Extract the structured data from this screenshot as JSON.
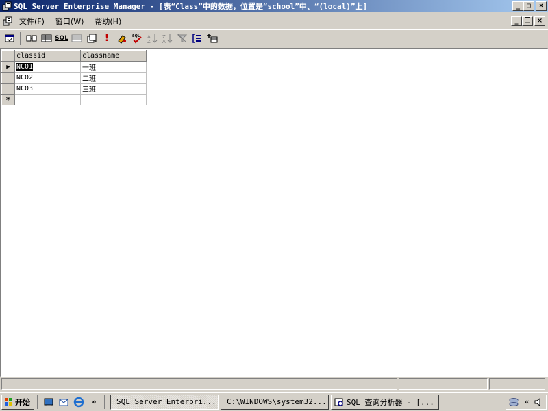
{
  "window": {
    "title": "SQL Server Enterprise Manager - [表“Class”中的数据，位置是“school”中、“(local)”上]",
    "minimize": "_",
    "restore": "❐",
    "close": "×"
  },
  "menu": {
    "items": [
      "文件(F)",
      "窗口(W)",
      "帮助(H)"
    ]
  },
  "toolbar": {
    "icons": [
      "properties-icon",
      "show-diagram-icon",
      "show-grid-icon",
      "sql-icon",
      "results-icon",
      "change-query-type-icon",
      "run-icon",
      "clear-icon",
      "verify-sql-icon",
      "sort-asc-icon",
      "sort-desc-icon",
      "remove-filter-icon",
      "group-by-icon",
      "add-table-icon"
    ],
    "sql_label": "SQL",
    "run_label": "!"
  },
  "grid": {
    "columns": [
      "classid",
      "classname"
    ],
    "rows": [
      [
        "NC01",
        "一班"
      ],
      [
        "NC02",
        "二班"
      ],
      [
        "NC03",
        "三班"
      ]
    ],
    "new_row_marker": "*",
    "current_row_marker": "▶"
  },
  "taskbar": {
    "start_label": "开始",
    "more": "»",
    "tasks": [
      "SQL Server Enterpri...",
      "C:\\WINDOWS\\system32...",
      "SQL 查询分析器 - [..."
    ],
    "tray_collapse": "«"
  },
  "colors": {
    "title_start": "#0a246a",
    "title_end": "#a6caf0",
    "face": "#d4d0c8"
  }
}
